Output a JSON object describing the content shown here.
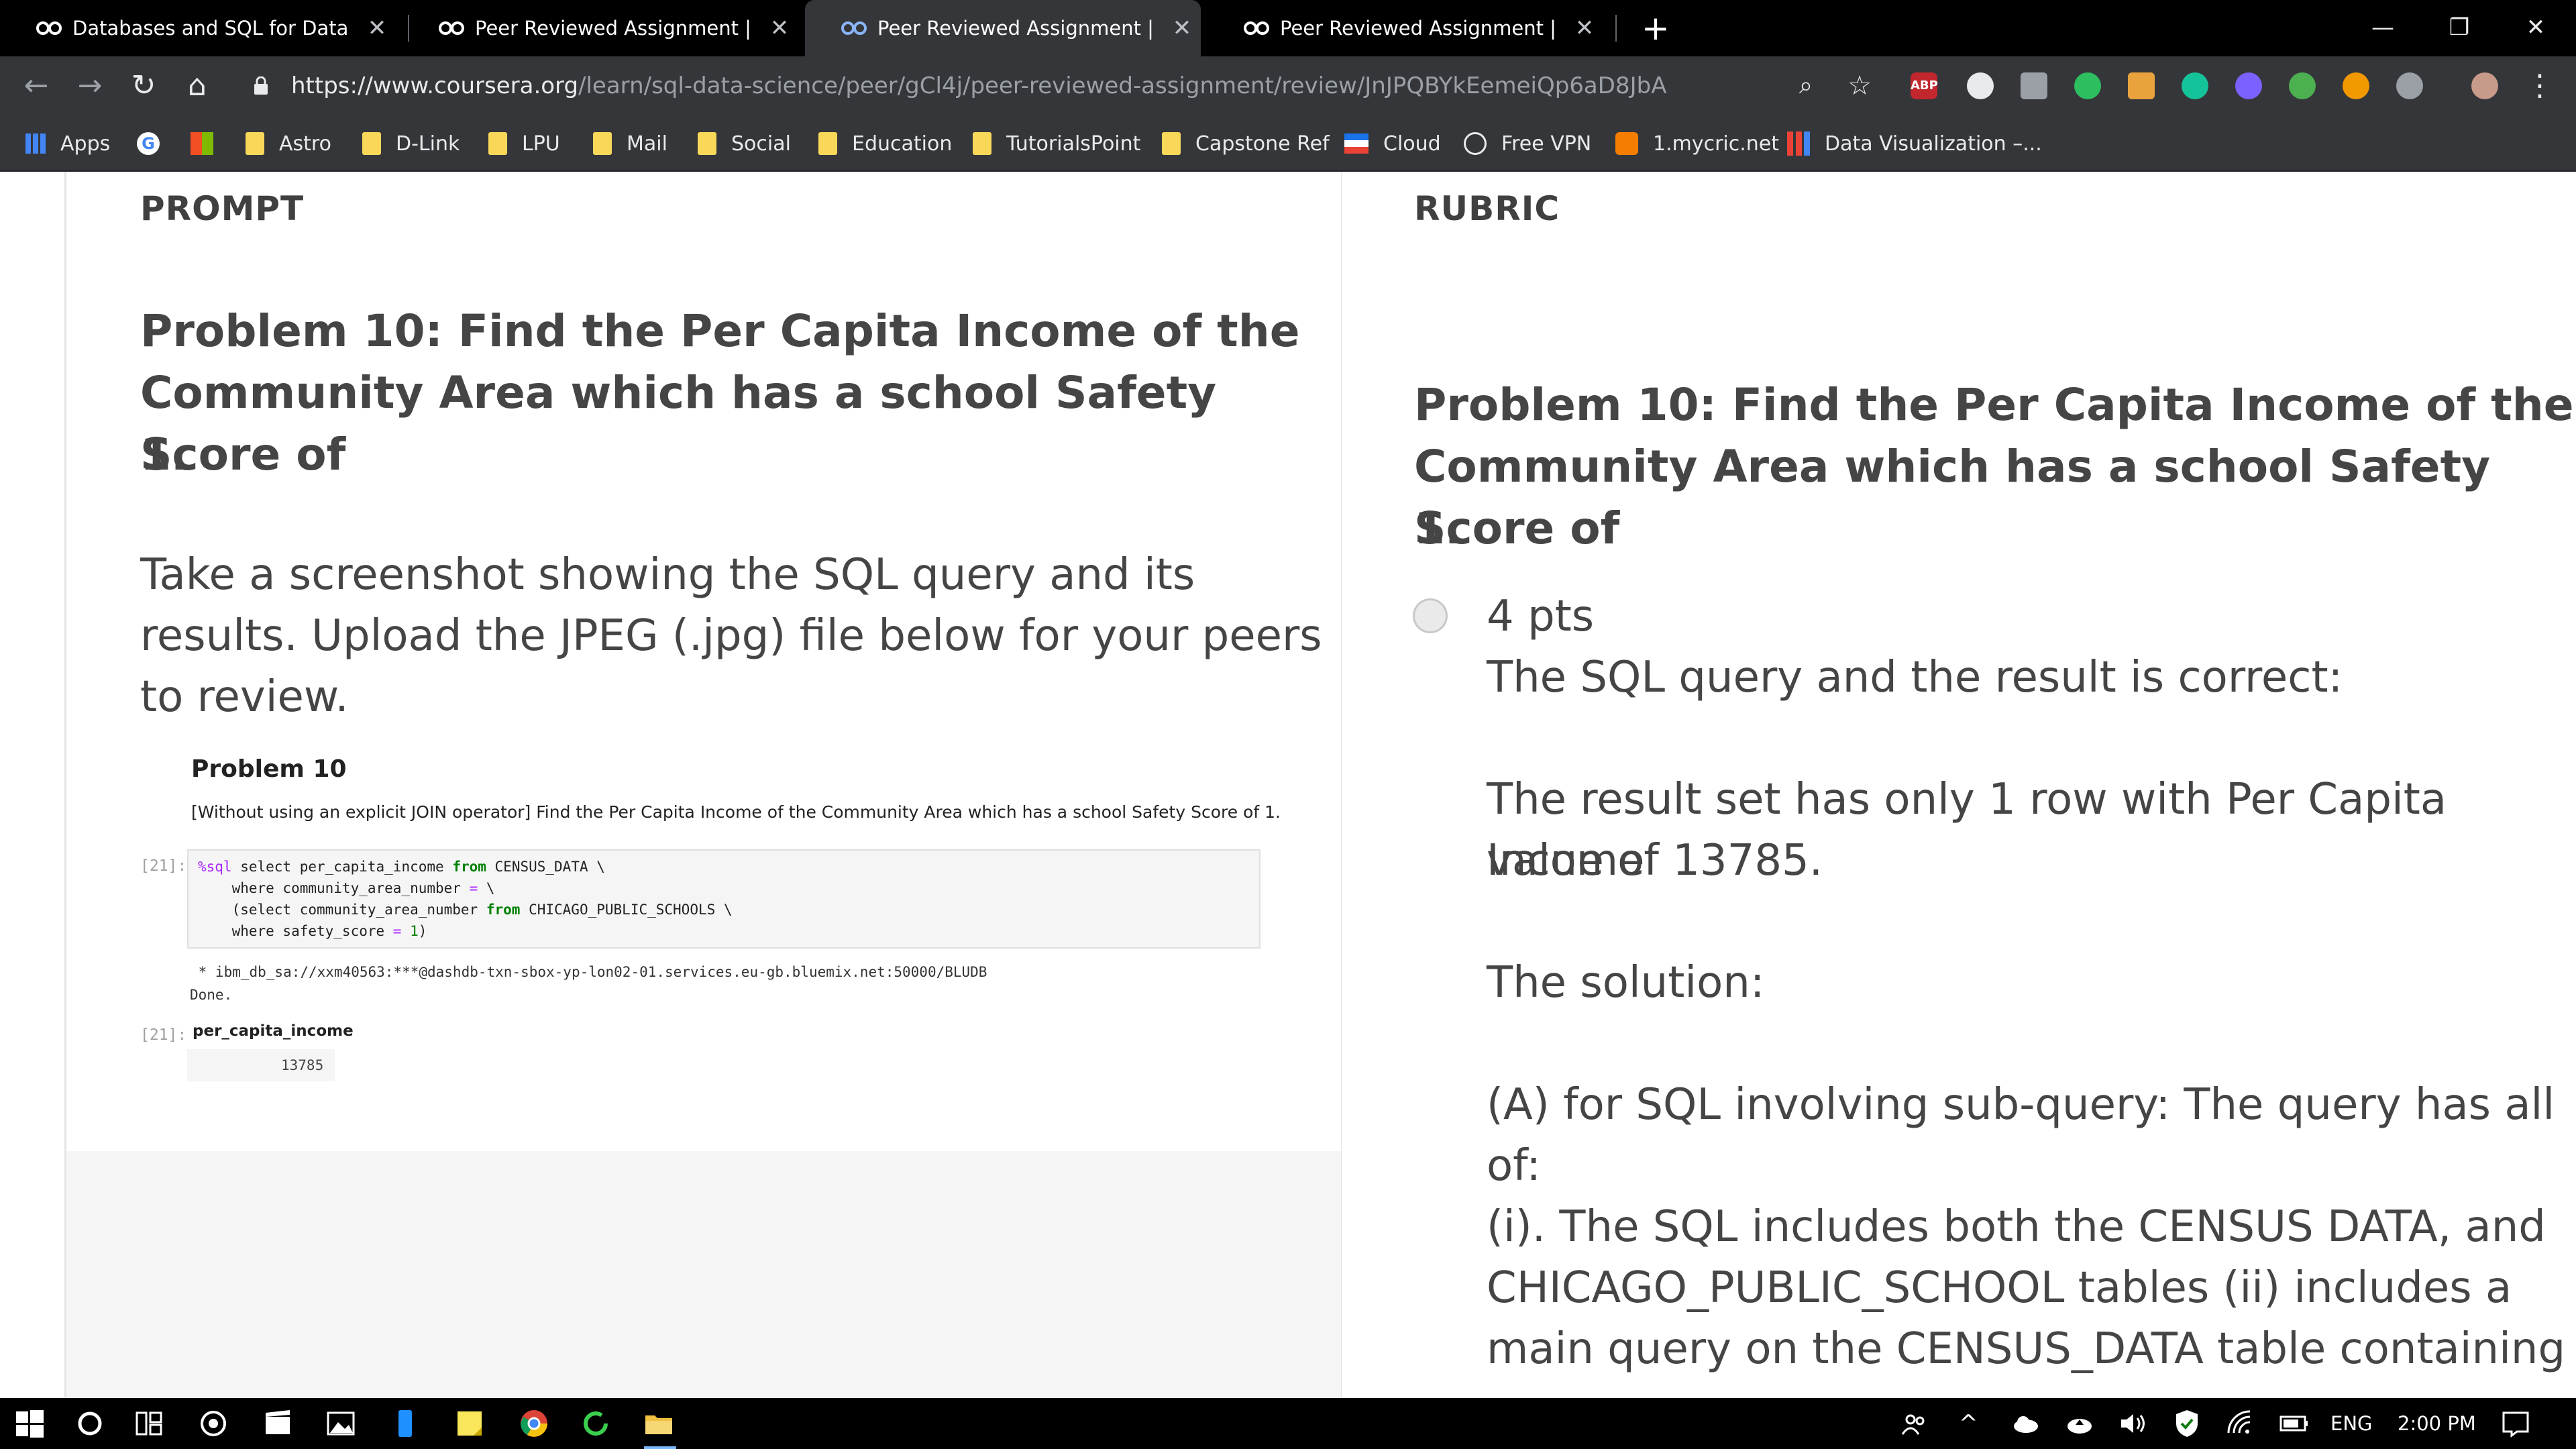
{
  "browser": {
    "tabs": [
      {
        "title": "Databases and SQL for Data Scie",
        "active": false
      },
      {
        "title": "Peer Reviewed Assignment | Cou",
        "active": false
      },
      {
        "title": "Peer Reviewed Assignment | Cou",
        "active": true
      },
      {
        "title": "Peer Reviewed Assignment | Cou",
        "active": false
      }
    ],
    "tab_close_glyph": "✕",
    "new_tab_glyph": "+",
    "window_controls": {
      "minimize": "—",
      "restore": "❐",
      "close": "✕"
    },
    "url_host": "https://www.coursera.org",
    "url_path": "/learn/sql-data-science/peer/gCl4j/peer-reviewed-assignment/review/JnJPQBYkEemeiQp6aD8JbA",
    "extensions": [
      "ABP"
    ],
    "bookmarks": [
      "Apps",
      "Astro",
      "D-Link",
      "LPU",
      "Mail",
      "Social",
      "Education",
      "TutorialsPoint",
      "Capstone Ref",
      "Cloud",
      "Free VPN",
      "1.mycric.net",
      "Data Visualization –..."
    ]
  },
  "prompt": {
    "heading": "PROMPT",
    "problem_lines": [
      "Problem 10: Find the Per Capita Income of the",
      "Community Area which has a school Safety Score of",
      "1."
    ],
    "instruction_lines": [
      "Take a screenshot showing the SQL query and its",
      "results. Upload the JPEG (.jpg) file below for your peers",
      "to review."
    ],
    "notebook": {
      "title": "Problem 10",
      "description": "[Without using an explicit JOIN operator] Find the Per Capita Income of the Community Area which has a school Safety Score of 1.",
      "in_prompt": "[21]:",
      "code": [
        "%sql select per_capita_income from CENSUS_DATA \\",
        "     where community_area_number = \\",
        "     (select community_area_number from CHICAGO_PUBLIC_SCHOOLS \\",
        "     where safety_score = 1)"
      ],
      "output_lines": [
        " * ibm_db_sa://xxm40563:***@dashdb-txn-sbox-yp-lon02-01.services.eu-gb.bluemix.net:50000/BLUDB",
        "Done."
      ],
      "out_prompt": "[21]:",
      "column": "per_capita_income",
      "value": "13785"
    }
  },
  "rubric": {
    "heading": "RUBRIC",
    "problem_lines": [
      "Problem 10: Find the Per Capita Income of the",
      "Community Area which has a school Safety Score of",
      "1."
    ],
    "points": "4 pts",
    "lines": [
      "The SQL query and the result is correct:",
      "",
      "The result set has only 1 row with Per Capita Income",
      "value of 13785.",
      "",
      "The solution:",
      "",
      "(A) for SQL involving sub-query: The query has all of:",
      "",
      "(i). The SQL includes both the CENSUS DATA, and",
      "CHICAGO_PUBLIC_SCHOOL tables (ii) includes a",
      "main query on the CENSUS_DATA table containing"
    ]
  },
  "taskbar": {
    "language": "ENG",
    "time": "2:00 PM"
  },
  "colors": {
    "tab_bar": "#000000",
    "toolbar": "#35363a",
    "folder": "#f9d859",
    "text": "#454545"
  }
}
